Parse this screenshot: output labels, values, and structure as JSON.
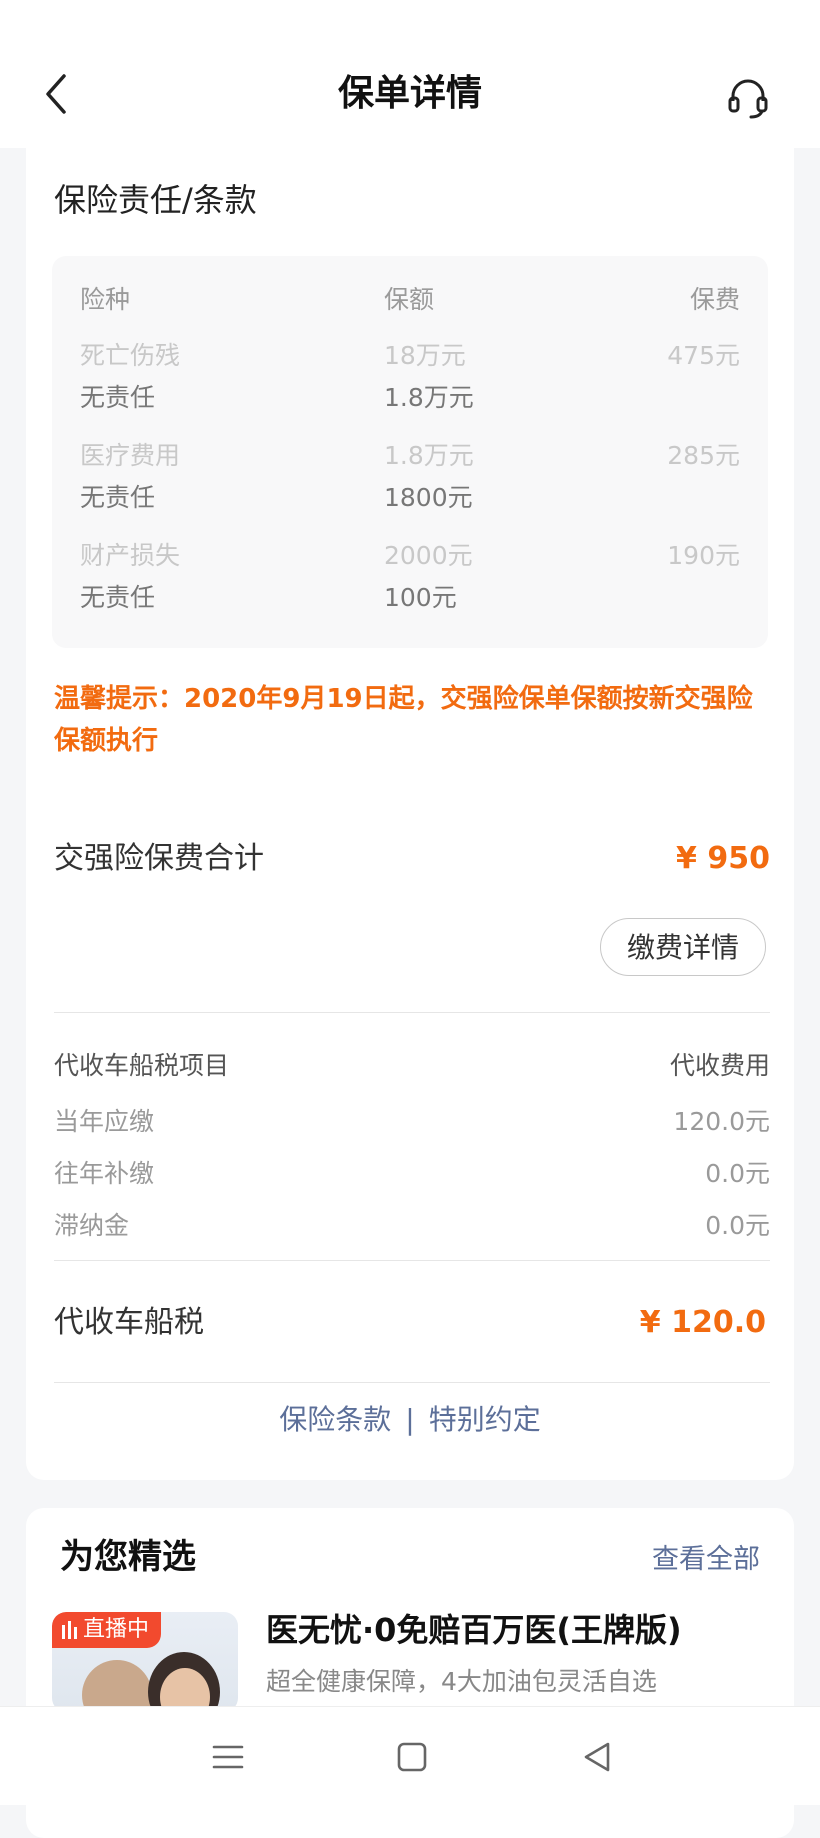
{
  "header": {
    "title": "保单详情"
  },
  "coverage": {
    "section_title": "保险责任/条款",
    "columns": [
      "险种",
      "保额",
      "保费"
    ],
    "rows": [
      [
        "死亡伤残",
        "18万元",
        "475元"
      ],
      [
        "无责任",
        "1.8万元",
        ""
      ],
      [
        "医疗费用",
        "1.8万元",
        "285元"
      ],
      [
        "无责任",
        "1800元",
        ""
      ],
      [
        "财产损失",
        "2000元",
        "190元"
      ],
      [
        "无责任",
        "100元",
        ""
      ]
    ]
  },
  "notice": "温馨提示：2020年9月19日起，交强险保单保额按新交强险保额执行",
  "premium": {
    "label": "交强险保费合计",
    "value": "¥ 950",
    "detail_button": "缴费详情"
  },
  "vehicle_tax": {
    "header_left": "代收车船税项目",
    "header_right": "代收费用",
    "items": [
      [
        "当年应缴",
        "120.0元"
      ],
      [
        "往年补缴",
        "0.0元"
      ],
      [
        "滞纳金",
        "0.0元"
      ]
    ],
    "total_label": "代收车船税",
    "total_value": "¥ 120.0"
  },
  "links": {
    "terms": "保险条款",
    "separator": "|",
    "special": "特别约定"
  },
  "picks": {
    "title": "为您精选",
    "view_all": "查看全部",
    "product": {
      "badge": "直播中",
      "name": "医无忧·0免赔百万医(王牌版)",
      "desc": "超全健康保障，4大加油包灵活自选"
    }
  },
  "colors": {
    "accent": "#f26b10",
    "link": "#5c6f99",
    "live_badge": "#f24a2e"
  },
  "icons": [
    "app-notification-icon",
    "back-arrow-icon",
    "customer-service-icon",
    "menu-icon",
    "home-square-icon",
    "back-triangle-icon"
  ]
}
